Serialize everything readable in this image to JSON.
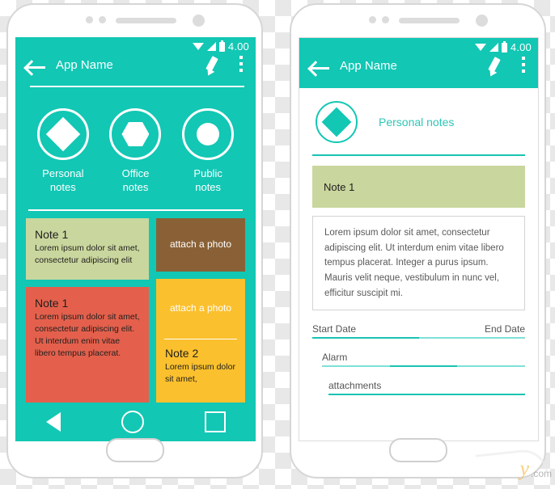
{
  "statusbar": {
    "time": "4.00",
    "wifi_icon": "wifi-icon",
    "signal_icon": "signal-icon",
    "battery_icon": "battery-icon"
  },
  "appbar": {
    "title": "App Name",
    "back_icon": "back-arrow-icon",
    "edit_icon": "pencil-icon",
    "overflow_icon": "kebab-menu-icon"
  },
  "left_phone": {
    "categories": [
      {
        "label": "Personal\nnotes",
        "label_line1": "Personal",
        "label_line2": "notes",
        "shape": "diamond"
      },
      {
        "label": "Office\nnotes",
        "label_line1": "Office",
        "label_line2": "notes",
        "shape": "hexagon"
      },
      {
        "label": "Public\nnotes",
        "label_line1": "Public",
        "label_line2": "notes",
        "shape": "circle"
      }
    ],
    "cards": {
      "green_note": {
        "title": "Note 1",
        "body": "Lorem ipsum dolor sit amet, consectetur adipiscing elit",
        "color": "#c9d69d"
      },
      "red_note": {
        "title": "Note 1",
        "body": "Lorem ipsum dolor sit amet, consectetur adipiscing elit. Ut interdum enim vitae libero tempus placerat.",
        "color": "#e4604c"
      },
      "brown_photo": {
        "label": "attach a photo",
        "color": "#8a6136"
      },
      "yellow_photo": {
        "label": "attach a photo",
        "title": "Note 2",
        "body": "Lorem ipsum dolor sit amet,",
        "color": "#fbc02d"
      }
    },
    "navbar": {
      "back_icon": "nav-back-triangle-icon",
      "home_icon": "nav-home-circle-icon",
      "recents_icon": "nav-recents-square-icon"
    }
  },
  "right_phone": {
    "header": {
      "label": "Personal notes",
      "shape": "diamond"
    },
    "note_band": {
      "title": "Note 1",
      "color": "#c9d69d"
    },
    "note_text": "Lorem ipsum dolor sit amet, consectetur adipiscing elit. Ut interdum enim vitae libero tempus placerat. Integer a purus ipsum. Mauris velit neque, vestibulum in nunc vel, efficitur suscipit mi.",
    "fields": [
      {
        "start_label": "Start Date",
        "end_label": "End Date"
      },
      {
        "label": "Alarm"
      },
      {
        "label": "attachments"
      }
    ]
  },
  "watermark": {
    "text": ".com",
    "mark": "y"
  },
  "colors": {
    "teal": "#12c7b4",
    "teal_accent": "#19c4b2",
    "teal_light": "#7fe0d6",
    "green": "#c9d69d",
    "red": "#e4604c",
    "brown": "#8a6136",
    "yellow": "#fbc02d",
    "frame": "#d6d6d6"
  }
}
